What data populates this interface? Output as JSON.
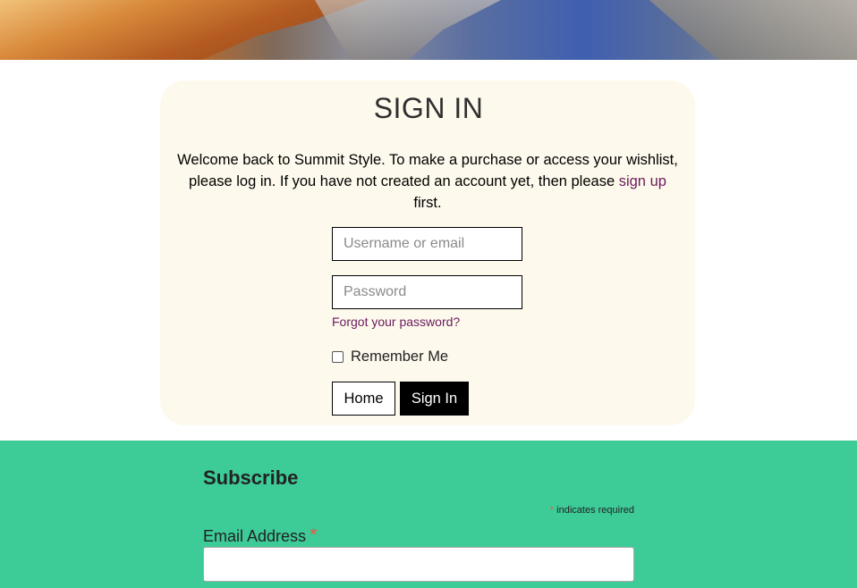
{
  "signin": {
    "title": "SIGN IN",
    "intro_text": "Welcome back to Summit Style. To make a purchase or access your wishlist, please log in. If you have not created an account yet, then please",
    "signup_link": "sign up",
    "intro_suffix": "first.",
    "username_placeholder": "Username or email",
    "password_placeholder": "Password",
    "forgot_link": "Forgot your password?",
    "remember_label": "Remember Me",
    "home_button": "Home",
    "signin_button": "Sign In"
  },
  "subscribe": {
    "title": "Subscribe",
    "required_star": "*",
    "required_note": "indicates required",
    "email_label": "Email Address",
    "email_star": "*"
  },
  "colors": {
    "card_background": "#fdf9ec",
    "link": "#6b1a5c",
    "subscribe_background": "#3dcb98",
    "required_star": "#e85c41"
  },
  "icons": {
    "remember_checkbox": "checkbox-unchecked-icon"
  }
}
